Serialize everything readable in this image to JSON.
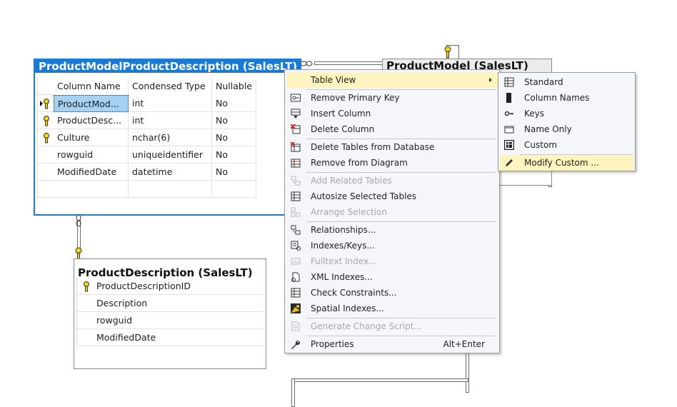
{
  "table_main": {
    "title": "ProductModelProductDescription (SalesLT)",
    "headers": [
      "Column Name",
      "Condensed Type",
      "Nullable"
    ],
    "rows": [
      {
        "name": "ProductMod...",
        "type": "int",
        "nullable": "No"
      },
      {
        "name": "ProductDesc...",
        "type": "int",
        "nullable": "No"
      },
      {
        "name": "Culture",
        "type": "nchar(6)",
        "nullable": "No"
      },
      {
        "name": "rowguid",
        "type": "uniqueidentifier",
        "nullable": "No"
      },
      {
        "name": "ModifiedDate",
        "type": "datetime",
        "nullable": "No"
      }
    ]
  },
  "table_desc": {
    "title": "ProductDescription (SalesLT)",
    "rows": [
      "ProductDescriptionID",
      "Description",
      "rowguid",
      "ModifiedDate"
    ]
  },
  "table_model": {
    "title": "ProductModel (SalesLT)"
  },
  "context_menu": {
    "items": [
      "Table View",
      "Remove Primary Key",
      "Insert Column",
      "Delete Column",
      "Delete Tables from Database",
      "Remove from Diagram",
      "Add Related Tables",
      "Autosize Selected Tables",
      "Arrange Selection",
      "Relationships...",
      "Indexes/Keys...",
      "Fulltext Index...",
      "XML Indexes...",
      "Check Constraints...",
      "Spatial Indexes...",
      "Generate Change Script...",
      "Properties"
    ],
    "properties_shortcut": "Alt+Enter"
  },
  "submenu": {
    "items": [
      "Standard",
      "Column Names",
      "Keys",
      "Name Only",
      "Custom",
      "Modify Custom ..."
    ]
  },
  "colors": {
    "selection_blue": "#1a7bd6",
    "highlight": "#fdf4bf",
    "key_yellow": "#f2d41c"
  }
}
